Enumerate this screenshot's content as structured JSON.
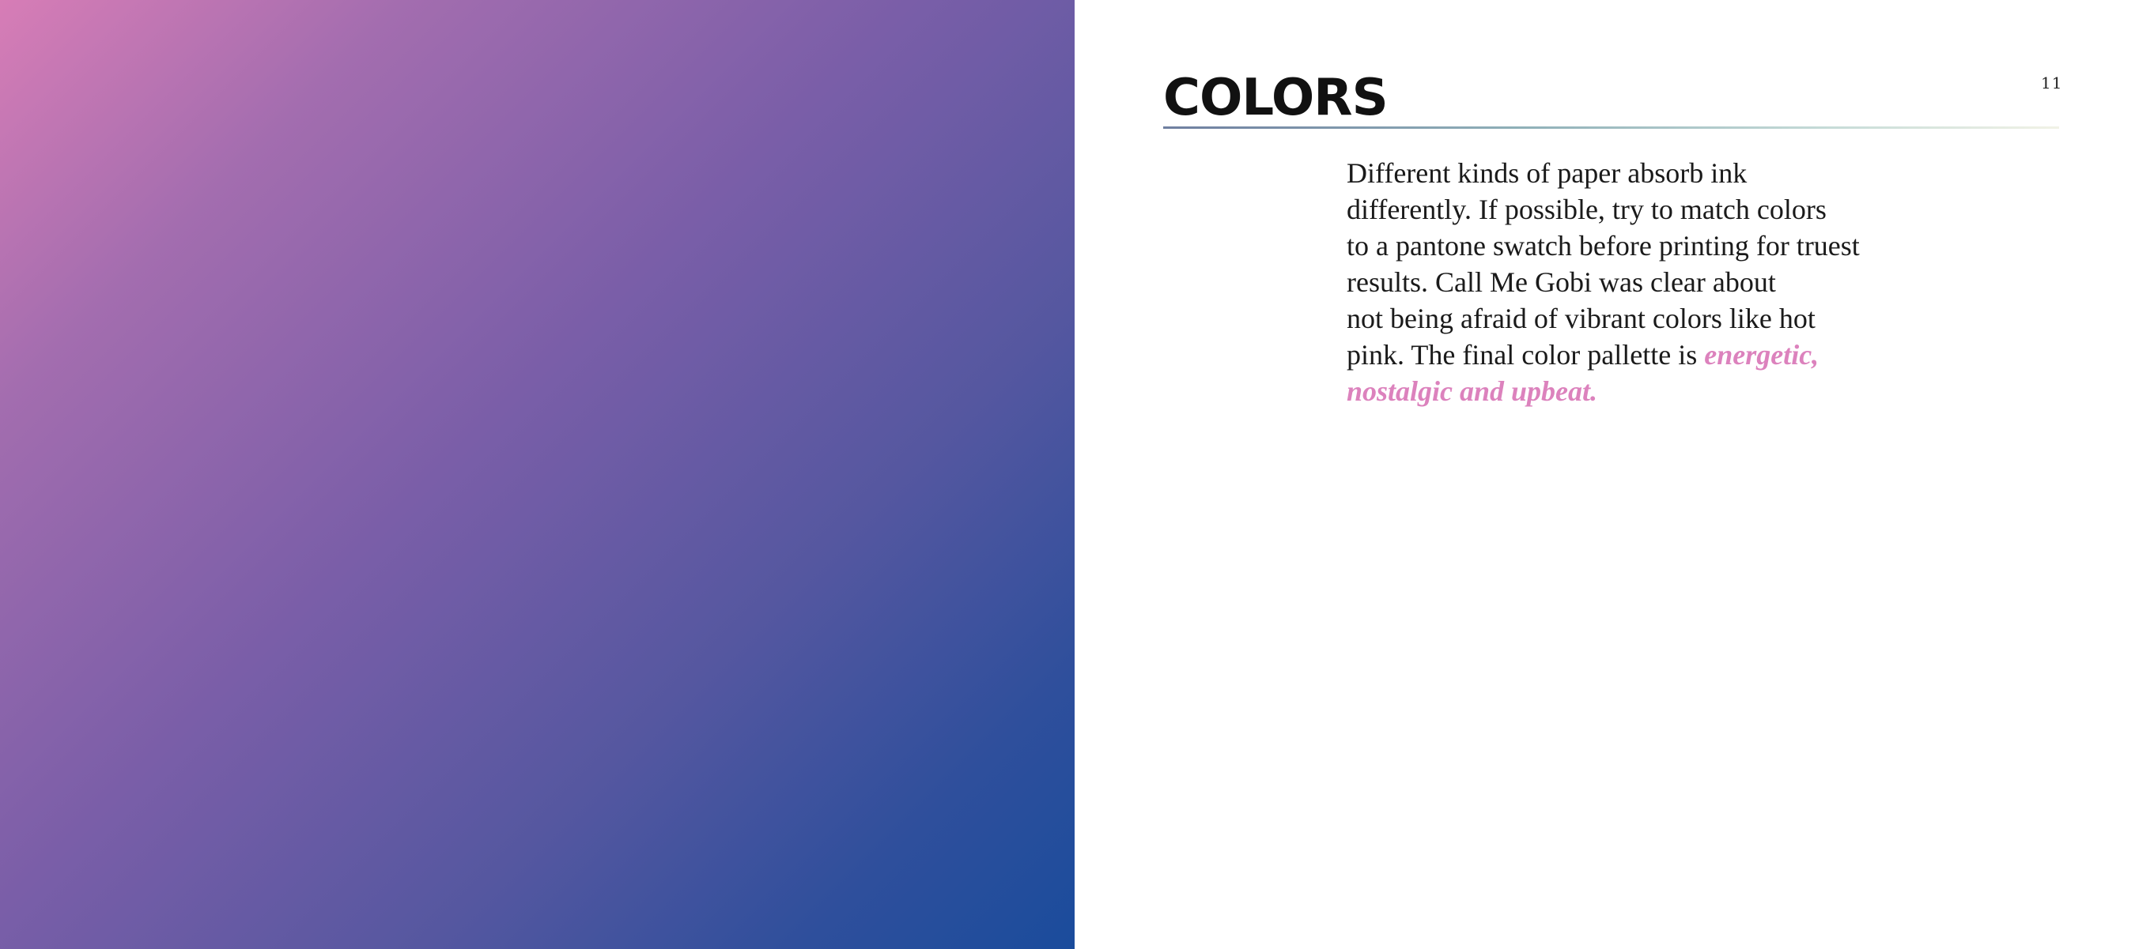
{
  "page": {
    "number": "11",
    "gradient_colors": [
      "#d77db6",
      "#7a5ea8",
      "#1a4c9c"
    ]
  },
  "section": {
    "title": "COLORS"
  },
  "body": {
    "lines": [
      "Different kinds of paper absorb ink",
      "differently. If possible, try to match colors",
      "to a pantone swatch before printing for truest",
      "results. Call Me Gobi was clear about",
      "not being afraid of vibrant colors like hot",
      "pink. The final color pallette is "
    ],
    "highlight_line1": "energetic,",
    "highlight_line2": "nostalgic and upbeat.",
    "highlight_color": "#dc82bd"
  }
}
